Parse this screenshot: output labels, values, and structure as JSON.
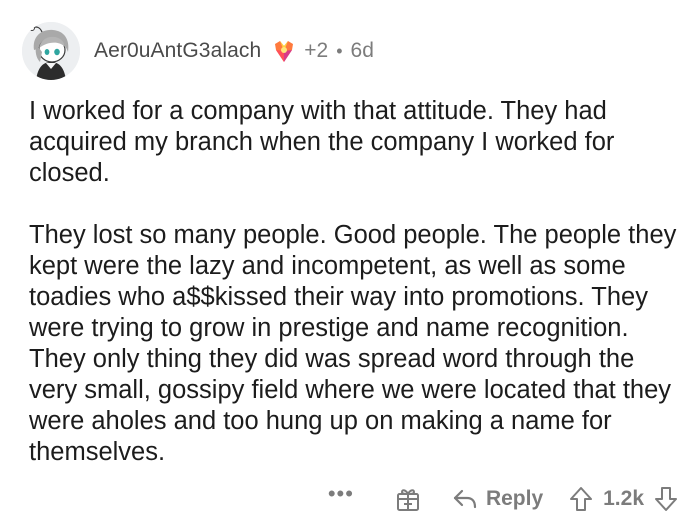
{
  "comment": {
    "author": "Aer0uAntG3alach",
    "award_count": "+2",
    "separator": "•",
    "age": "6d",
    "paragraphs": [
      "I worked for a company with that attitude. They had acquired my branch when the company I worked for closed.",
      "They lost so many people. Good people. The people they kept were the lazy and incompetent, as well as some toadies who a$$kissed their way into promotions. They were trying to grow in prestige and name recognition. They only thing they did was spread word through the very small, gossipy field where we were located that they were aholes and too hung up on making a name for themselves."
    ]
  },
  "actions": {
    "more": "•••",
    "reply_label": "Reply",
    "score": "1.2k"
  },
  "icons": {
    "avatar": "snoo-avatar",
    "award": "award-icon",
    "give_award": "gift-icon",
    "reply": "reply-arrow-icon",
    "upvote": "upvote-arrow-icon",
    "downvote": "downvote-arrow-icon"
  },
  "colors": {
    "text": "#1c1c1c",
    "muted": "#7c7c7c",
    "author": "#4a4a4a",
    "avatar_bg": "#edeff1"
  }
}
